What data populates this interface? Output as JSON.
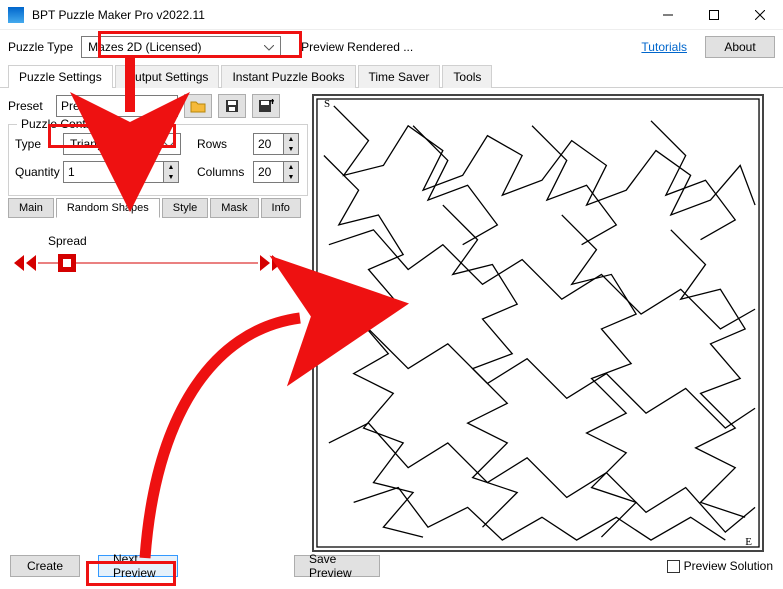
{
  "window": {
    "title": "BPT Puzzle Maker Pro v2022.11"
  },
  "top": {
    "puzzle_type_label": "Puzzle Type",
    "puzzle_type_value": "Mazes 2D (Licensed)",
    "preview_status": "Preview Rendered ...",
    "tutorials_link": "Tutorials",
    "about_btn": "About"
  },
  "tabs": {
    "items": [
      "Puzzle Settings",
      "Output Settings",
      "Instant Puzzle Books",
      "Time Saver",
      "Tools"
    ],
    "active": 0
  },
  "preset": {
    "label": "Preset",
    "value": "Pre"
  },
  "puzzle_control": {
    "legend": "Puzzle Control",
    "type_label": "Type",
    "type_value": "Triangulation",
    "rows_label": "Rows",
    "rows_value": "20",
    "quantity_label": "Quantity",
    "quantity_value": "1",
    "columns_label": "Columns",
    "columns_value": "20"
  },
  "subtabs": {
    "items": [
      "Main",
      "Random Shapes",
      "Style",
      "Mask",
      "Info"
    ],
    "active": 1
  },
  "spread": {
    "label": "Spread"
  },
  "maze": {
    "start_label": "S",
    "end_label": "E"
  },
  "bottom": {
    "create_btn": "Create",
    "next_preview_btn": "Next Preview",
    "save_preview_btn": "Save Preview",
    "preview_solution_label": "Preview Solution"
  },
  "colors": {
    "annotation": "#e11",
    "link": "#0066cc"
  }
}
